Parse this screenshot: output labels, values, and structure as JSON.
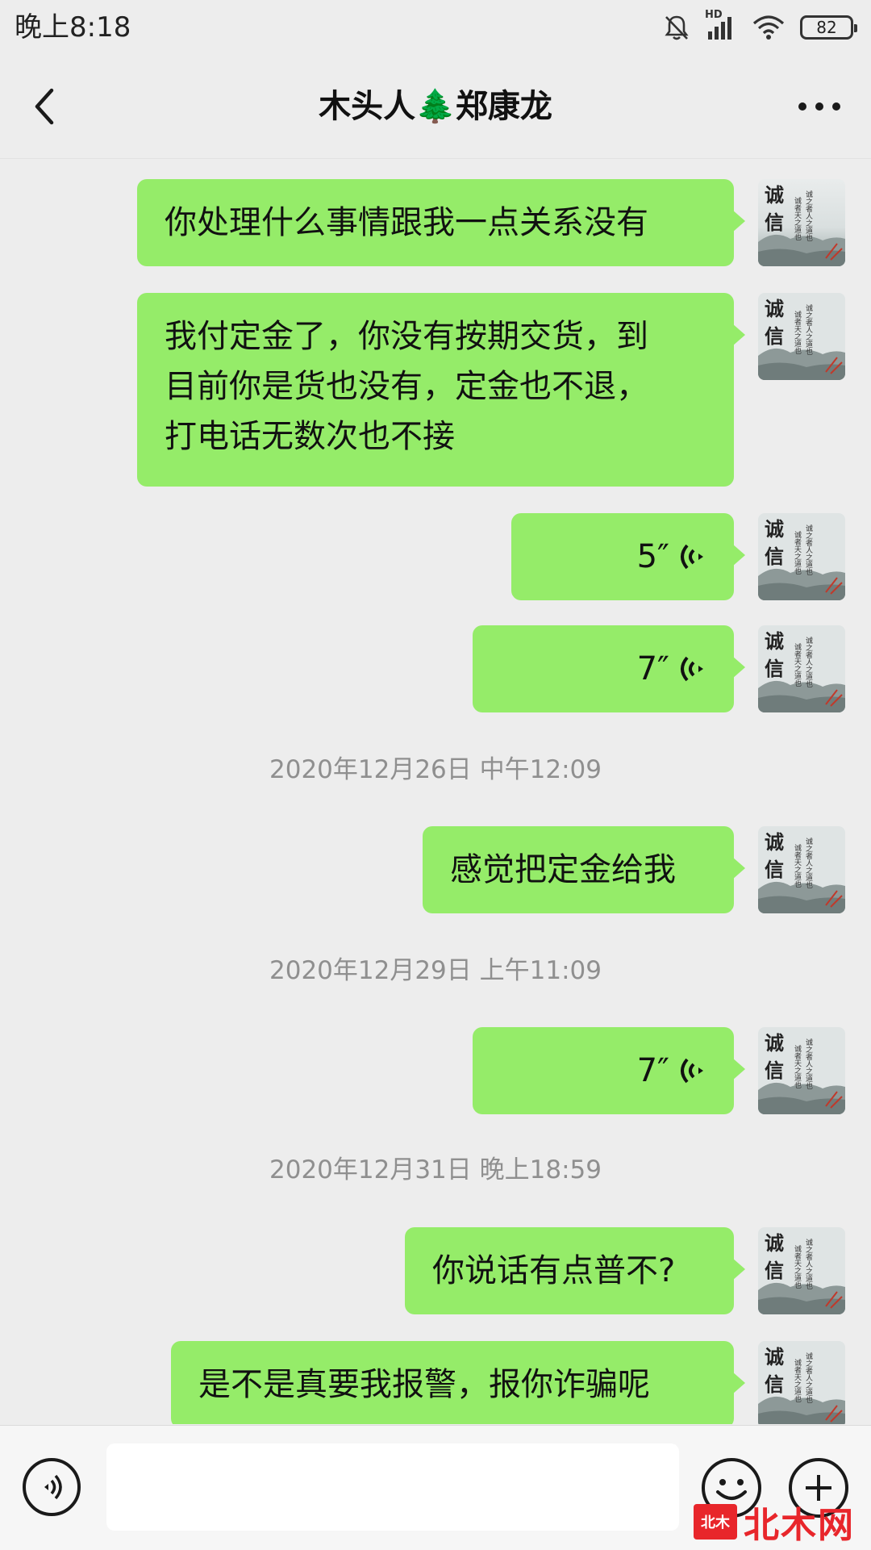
{
  "status_bar": {
    "time": "晚上8:18",
    "network": "HD",
    "battery": "82",
    "icons": [
      "notifications-muted-icon",
      "signal-icon",
      "wifi-icon",
      "battery-icon"
    ]
  },
  "header": {
    "title": "木头人🌲郑康龙",
    "back_icon": "chevron-left-icon",
    "more_icon": "more-horizontal-icon"
  },
  "avatar": {
    "big_chars": [
      "诚",
      "信"
    ],
    "small_text": [
      "诚之者人之道也",
      "诚者天之道也"
    ]
  },
  "messages": [
    {
      "type": "text",
      "lines": [
        "你处理什么事情跟我一点关系没有"
      ]
    },
    {
      "type": "text",
      "lines": [
        "我付定金了，你没有按期交货，到",
        "目前你是货也没有，定金也不退，",
        "打电话无数次也不接"
      ]
    },
    {
      "type": "voice",
      "duration": "5″"
    },
    {
      "type": "voice",
      "duration": "7″"
    },
    {
      "type": "timestamp",
      "text": "2020年12月26日 中午12:09"
    },
    {
      "type": "text",
      "lines": [
        "感觉把定金给我"
      ]
    },
    {
      "type": "timestamp",
      "text": "2020年12月29日 上午11:09"
    },
    {
      "type": "voice",
      "duration": "7″"
    },
    {
      "type": "timestamp",
      "text": "2020年12月31日 晚上18:59"
    },
    {
      "type": "text",
      "lines": [
        "你说话有点普不?"
      ]
    },
    {
      "type": "text",
      "lines": [
        "是不是真要我报警，报你诈骗呢"
      ]
    }
  ],
  "input_bar": {
    "text_value": "",
    "icons": [
      "voice-input-icon",
      "emoji-icon",
      "plus-icon"
    ]
  },
  "watermark": {
    "badge": "北木",
    "text": "北木网"
  },
  "colors": {
    "bubble": "#95ec69",
    "background": "#ededed",
    "timestamp": "#8f8f8f"
  }
}
